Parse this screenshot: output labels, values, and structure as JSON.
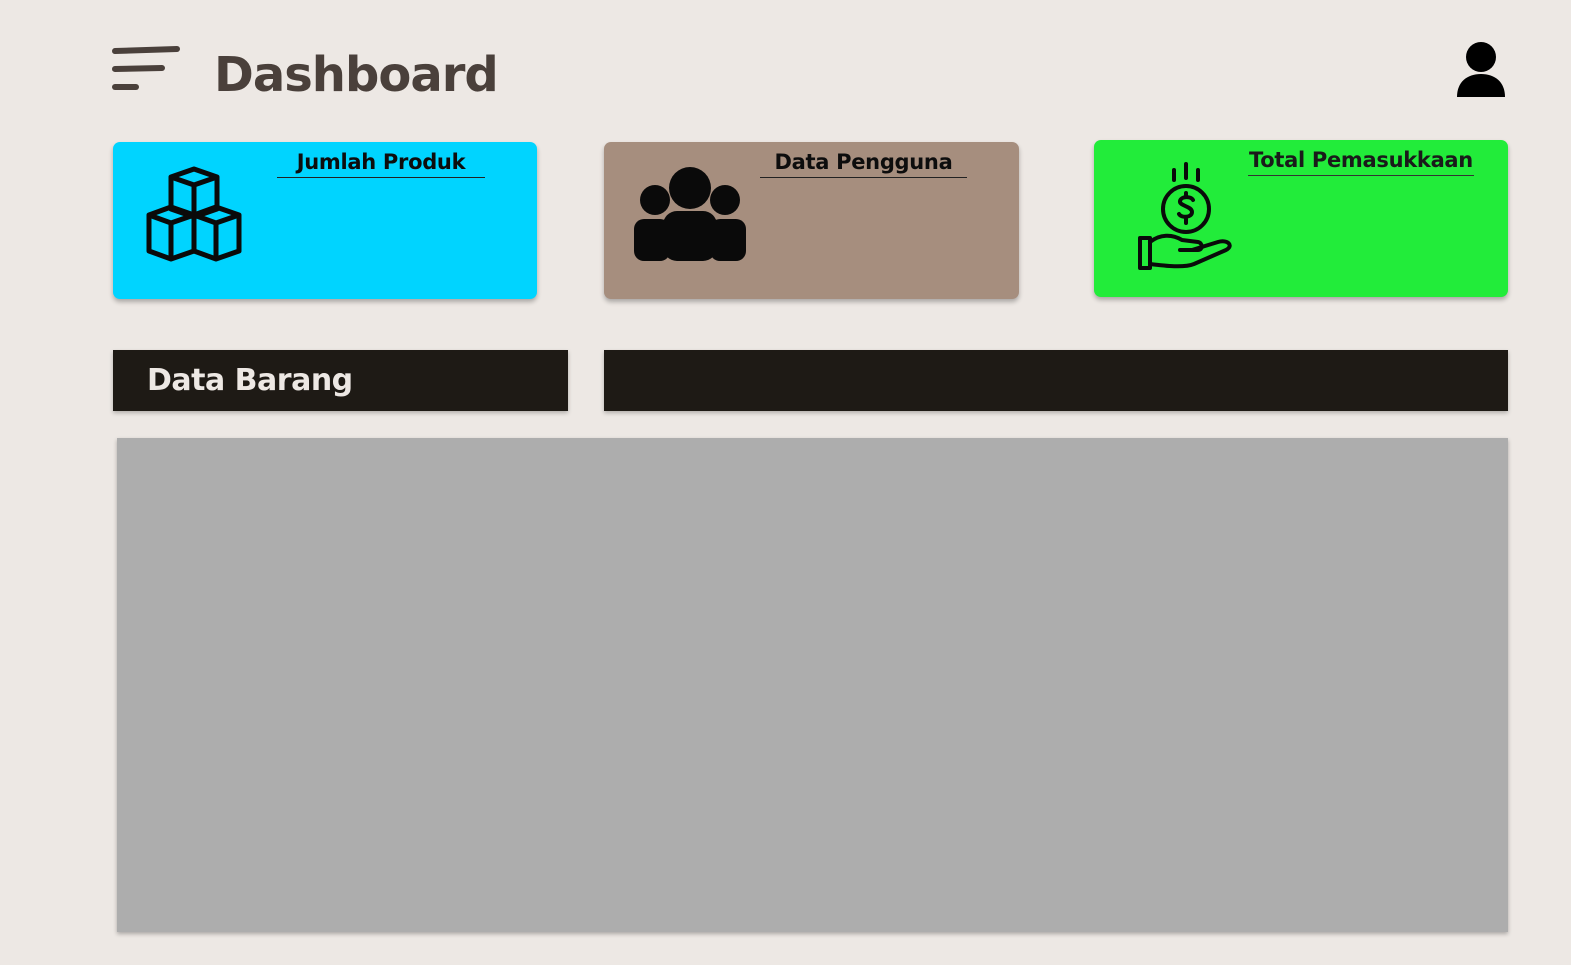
{
  "header": {
    "title": "Dashboard",
    "menu_icon": "menu-lines-icon",
    "profile_icon": "user-icon"
  },
  "cards": [
    {
      "title": "Jumlah Produk",
      "icon": "boxes-icon",
      "color": "#00d4ff"
    },
    {
      "title": "Data Pengguna",
      "icon": "users-group-icon",
      "color": "#a68e7e"
    },
    {
      "title": "Total Pemasukkaan",
      "icon": "money-hand-icon",
      "color": "#22ec3a"
    }
  ],
  "section": {
    "left_title": "Data Barang",
    "right_title": ""
  },
  "colors": {
    "background": "#ede8e4",
    "title_text": "#4a403b",
    "bar": "#1e1a15",
    "content_placeholder": "#adadad"
  }
}
